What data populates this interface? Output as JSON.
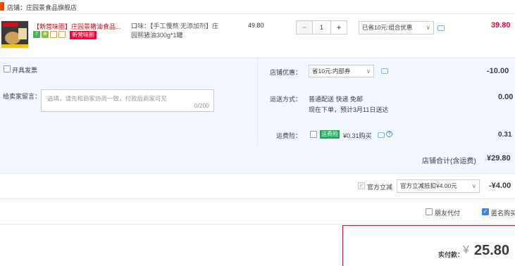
{
  "store": {
    "label": "店铺：庄园景食品旗舰店"
  },
  "item": {
    "title": "【新营味圈】庄园景猪油食品...",
    "tag_seven": "7",
    "tag_second": "⊕",
    "new_tag": "新营味圈",
    "spec_line1": "口味：【手工慢熬 无添加剂】庄",
    "spec_line2": "园熙猪油300g*1罐",
    "unit_price": "49.80",
    "qty_minus": "−",
    "qty_value": "1",
    "qty_plus": "+",
    "promo_selected": "已省10元:组合优惠",
    "total": "39.80"
  },
  "invoice": {
    "label": "开具发票"
  },
  "message": {
    "label": "给卖家留言：",
    "placeholder": "选填，请先和商家协商一致，付款后商家可见",
    "counter": "0/200"
  },
  "store_coupon": {
    "label": "店铺优惠：",
    "selected": "省10元:内部券",
    "amount": "-10.00"
  },
  "shipping": {
    "label": "运送方式：",
    "method": "普通配送 快递 免邮",
    "eta": "现在下单，预计3月11日送达",
    "amount": "0.00"
  },
  "insurance": {
    "label": "运费险：",
    "badge": "运费险",
    "price": "¥0.31购买",
    "amount": "0.31"
  },
  "store_total": {
    "label": "店铺合计(含运费)",
    "amount": "¥29.80"
  },
  "discount": {
    "check_label": "官方立减",
    "selected": "官方立减抵扣¥4.00元",
    "amount": "-¥4.00"
  },
  "options": {
    "friend_pay": "朋友代付",
    "anonymous": "匿名购买"
  },
  "payment": {
    "label": "实付款：",
    "currency": "¥",
    "amount": "25.80"
  },
  "colors": {
    "accent": "#ff0036",
    "panel_bg": "#f2f7ff",
    "link_blue": "#3d88e4"
  }
}
